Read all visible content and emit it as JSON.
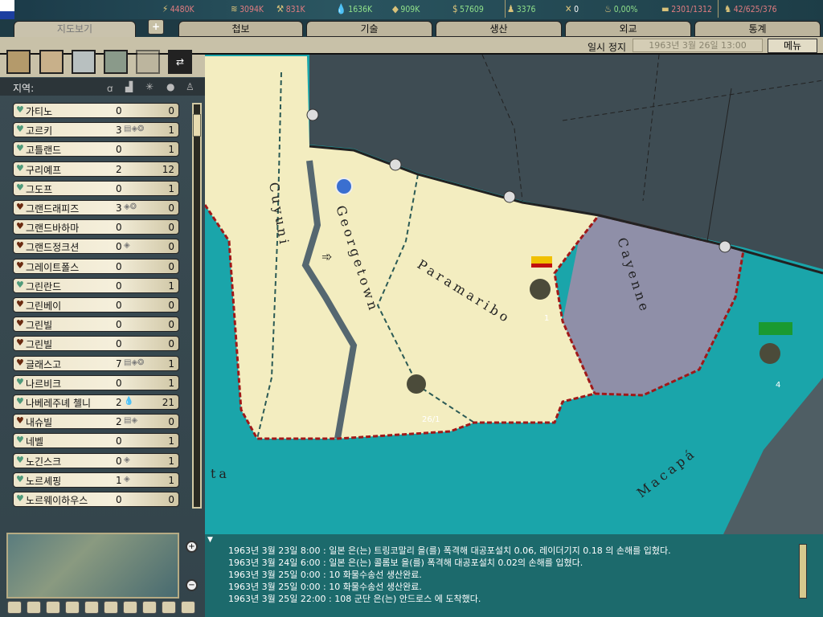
{
  "resources": [
    {
      "icon": "energy-icon",
      "value": "4480K",
      "color": "#e07c80"
    },
    {
      "icon": "metal-icon",
      "value": "3094K",
      "color": "#e07c80"
    },
    {
      "icon": "rare-materials-icon",
      "value": "831K",
      "color": "#e07c80"
    },
    {
      "icon": "oil-icon",
      "value": "1636K",
      "color": "#8fe08a"
    },
    {
      "icon": "supplies-icon",
      "value": "909K",
      "color": "#8fe08a"
    },
    {
      "icon": "money-icon",
      "value": "57609",
      "color": "#8fe08a"
    },
    {
      "icon": "manpower-icon",
      "value": "3376",
      "color": "#8fe08a"
    },
    {
      "icon": "transport-icon",
      "value": "0",
      "color": "#ffffff"
    },
    {
      "icon": "dissent-icon",
      "value": "0,00%",
      "color": "#8fe08a"
    },
    {
      "icon": "convoy-icon",
      "value": "2301/1312",
      "color": "#e07c80"
    },
    {
      "icon": "units-icon",
      "value": "42/625/376",
      "color": "#e07c80"
    }
  ],
  "tabs": [
    "지도보기",
    "첩보",
    "기술",
    "생산",
    "외교",
    "통계"
  ],
  "status": {
    "pause": "일시 정지",
    "date": "1963년 3월 26일 13:00",
    "menu": "메뉴"
  },
  "region_header": {
    "label": "지역:"
  },
  "regions": [
    {
      "name": "가티노",
      "a": "0",
      "extra": "",
      "b": "0",
      "owner": "green"
    },
    {
      "name": "고르키",
      "a": "3",
      "extra": "▤◈❂",
      "b": "1",
      "owner": "green"
    },
    {
      "name": "고틀랜드",
      "a": "0",
      "extra": "",
      "b": "1",
      "owner": "green"
    },
    {
      "name": "구리예프",
      "a": "2",
      "extra": "",
      "b": "12",
      "owner": "green"
    },
    {
      "name": "그도프",
      "a": "0",
      "extra": "",
      "b": "1",
      "owner": "green"
    },
    {
      "name": "그랜드래피즈",
      "a": "3",
      "extra": "◈❂",
      "b": "0",
      "owner": "brown"
    },
    {
      "name": "그랜드바하마",
      "a": "0",
      "extra": "",
      "b": "0",
      "owner": "brown"
    },
    {
      "name": "그랜드정크션",
      "a": "0",
      "extra": "◈",
      "b": "0",
      "owner": "brown"
    },
    {
      "name": "그레이트폴스",
      "a": "0",
      "extra": "",
      "b": "0",
      "owner": "brown"
    },
    {
      "name": "그린란드",
      "a": "0",
      "extra": "",
      "b": "1",
      "owner": "green"
    },
    {
      "name": "그린베이",
      "a": "0",
      "extra": "",
      "b": "0",
      "owner": "brown"
    },
    {
      "name": "그린빌",
      "a": "0",
      "extra": "",
      "b": "0",
      "owner": "brown"
    },
    {
      "name": "그린빌",
      "a": "0",
      "extra": "",
      "b": "0",
      "owner": "brown"
    },
    {
      "name": "글래스고",
      "a": "7",
      "extra": "▤◈❂",
      "b": "1",
      "owner": "brown"
    },
    {
      "name": "나르비크",
      "a": "0",
      "extra": "",
      "b": "1",
      "owner": "green"
    },
    {
      "name": "나베레주녜 첼니",
      "a": "2",
      "extra": "💧",
      "b": "21",
      "owner": "green"
    },
    {
      "name": "내슈빌",
      "a": "2",
      "extra": "▤◈",
      "b": "0",
      "owner": "brown"
    },
    {
      "name": "네벨",
      "a": "0",
      "extra": "",
      "b": "1",
      "owner": "green"
    },
    {
      "name": "노긴스크",
      "a": "0",
      "extra": "◈",
      "b": "1",
      "owner": "green"
    },
    {
      "name": "노르셰핑",
      "a": "1",
      "extra": "◈",
      "b": "1",
      "owner": "green"
    },
    {
      "name": "노르웨이하우스",
      "a": "0",
      "extra": "",
      "b": "0",
      "owner": "green"
    }
  ],
  "map": {
    "provinces": [
      "Cuyuni",
      "Georgetown",
      "Paramaribo",
      "Cayenne",
      "Macapá",
      "ta"
    ],
    "units": [
      {
        "label": "26/1"
      },
      {
        "label": "1"
      },
      {
        "label": "4"
      }
    ]
  },
  "log": [
    "1963년 3월 23일 8:00 : 일본 은(는) 트링코말리 을(를) 폭격해 대공포설치 0.06, 레이더기지 0.18 의 손해를 입혔다.",
    "1963년 3월 24일 6:00 : 일본 은(는) 콜롬보 을(를) 폭격해 대공포설치 0.02의 손해를 입혔다.",
    "1963년 3월 25일 0:00 : 10 화물수송선  생산완료.",
    "1963년 3월 25일 0:00 : 10 화물수송선  생산완료.",
    "1963년 3월 25일 22:00 : 108 군단 은(는) 안드로스 에 도착했다."
  ]
}
